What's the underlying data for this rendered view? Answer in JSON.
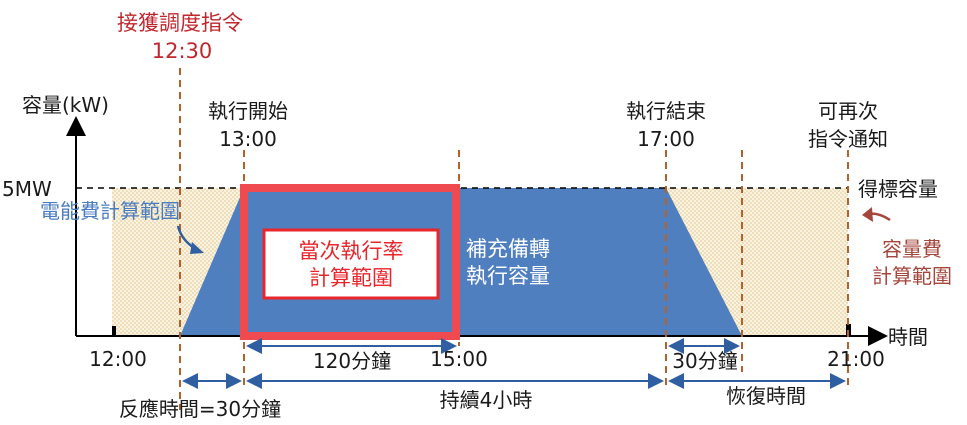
{
  "colors": {
    "trapezoid": "#4f7fbf",
    "highlight_border": "#ef4a4f",
    "inner_text_red": "#e8262c",
    "hatch": "#f3e3c0",
    "dashed_orange": "#b5612c",
    "arrow_blue": "#2f5fa0"
  },
  "dispatch": {
    "title": "接獲調度指令",
    "time": "12:30"
  },
  "y_axis": {
    "label": "容量(kW)",
    "level_label": "5MW"
  },
  "x_axis": {
    "label": "時間"
  },
  "labels": {
    "exec_start": "執行開始",
    "exec_start_time": "13:00",
    "exec_end": "執行結束",
    "exec_end_time": "17:00",
    "renotify_1": "可再次",
    "renotify_2": "指令通知",
    "awarded_capacity": "得標容量",
    "energy_fee_range": "電能費計算範圍",
    "capacity_fee_1": "容量費",
    "capacity_fee_2": "計算範圍",
    "rate_box_1": "當次執行率",
    "rate_box_2": "計算範圍",
    "supplement_1": "補充備轉",
    "supplement_2": "執行容量"
  },
  "times": {
    "t1200": "12:00",
    "t1500": "15:00",
    "t2100": "21:00"
  },
  "durations": {
    "d120": "120分鐘",
    "d30_recovery": "30分鐘",
    "response": "反應時間=30分鐘",
    "sustain": "持續4小時",
    "recovery": "恢復時間"
  }
}
